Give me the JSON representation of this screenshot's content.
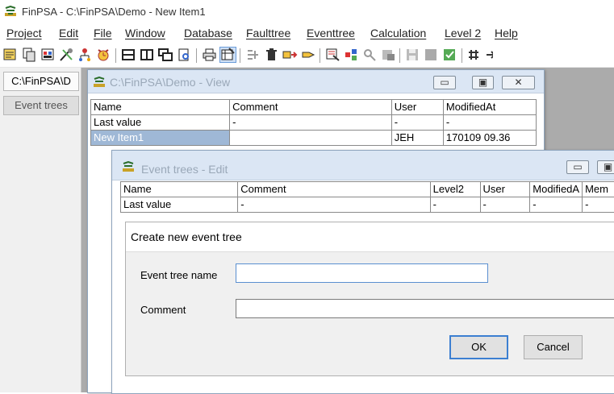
{
  "app": {
    "title": "FinPSA - C:\\FinPSA\\Demo - New Item1"
  },
  "menu": [
    "Project",
    "Edit",
    "File",
    "Window",
    "Database",
    "Faulttree",
    "Eventtree",
    "Calculation",
    "Level 2",
    "Help"
  ],
  "left_panel": {
    "path_button": "C:\\FinPSA\\D",
    "event_trees_button": "Event trees"
  },
  "view_window": {
    "title": "C:\\FinPSA\\Demo  - View",
    "columns": [
      "Name",
      "Comment",
      "User",
      "ModifiedAt"
    ],
    "rows": [
      [
        "Last value",
        "-",
        "-",
        "-"
      ],
      [
        "New Item1",
        "",
        "JEH",
        "170109 09.36"
      ]
    ]
  },
  "edit_window": {
    "title": "Event trees  - Edit",
    "columns": [
      "Name",
      "Comment",
      "Level2",
      "User",
      "ModifiedA",
      "Mem"
    ],
    "rows": [
      [
        "Last value",
        "-",
        "-",
        "-",
        "-",
        "-"
      ]
    ]
  },
  "dialog": {
    "title": "Create new event tree",
    "name_label": "Event tree name",
    "name_value": "",
    "comment_label": "Comment",
    "comment_value": "",
    "ok_label": "OK",
    "cancel_label": "Cancel"
  },
  "window_controls": {
    "minimize": "▭",
    "maximize": "▣",
    "close": "✕"
  },
  "colors": {
    "mdi_background": "#ababab",
    "window_caption": "#dbe6f4",
    "selection": "#9fb8d6",
    "focus_border": "#3c7fd1"
  }
}
